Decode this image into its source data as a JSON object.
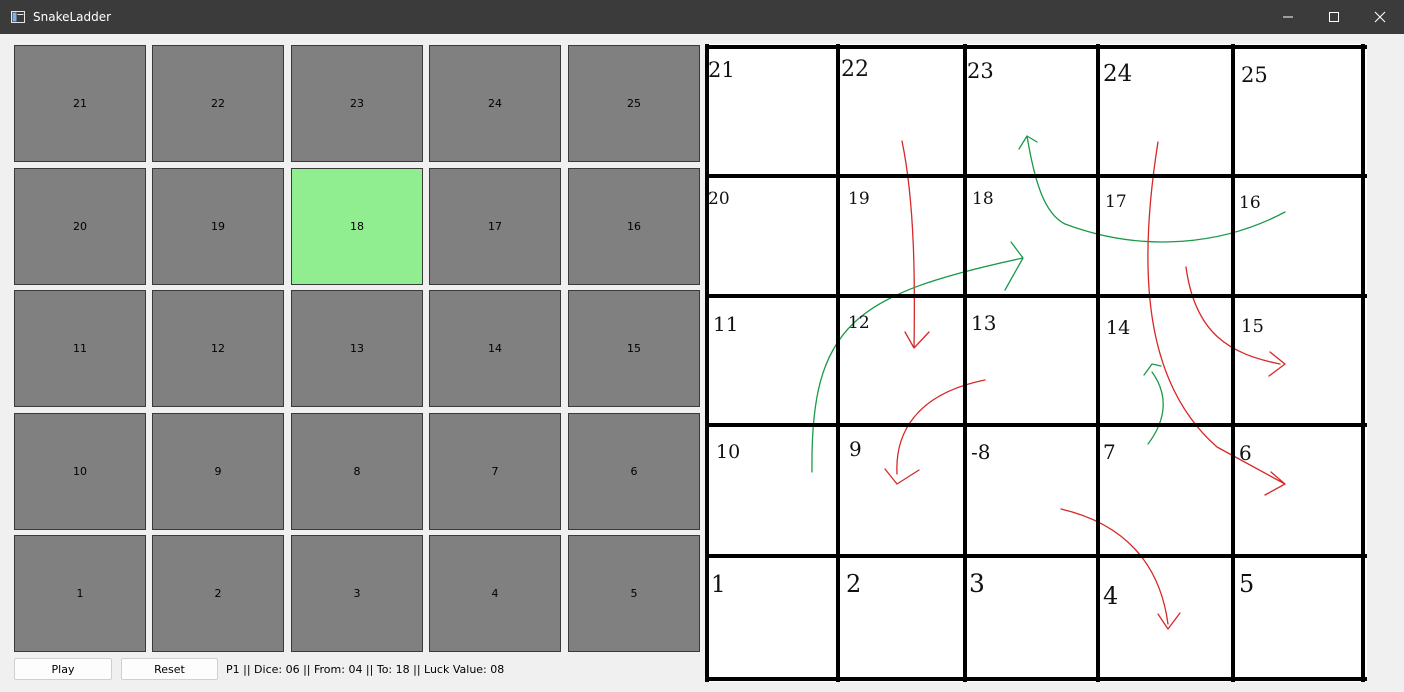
{
  "window": {
    "title": "SnakeLadder",
    "controls": [
      "minimize",
      "maximize",
      "close"
    ]
  },
  "colors": {
    "tile_default": "#808080",
    "tile_active": "#90ee90",
    "snake": "#e02020",
    "ladder": "#1a9a48",
    "grid": "#000000"
  },
  "game_board": {
    "rows": [
      [
        21,
        22,
        23,
        24,
        25
      ],
      [
        20,
        19,
        18,
        17,
        16
      ],
      [
        11,
        12,
        13,
        14,
        15
      ],
      [
        10,
        9,
        8,
        7,
        6
      ],
      [
        1,
        2,
        3,
        4,
        5
      ]
    ],
    "active_tile": 18
  },
  "controls": {
    "play_label": "Play",
    "reset_label": "Reset"
  },
  "status": {
    "text": "P1 || Dice: 06 || From: 04 || To: 18 || Luck Value: 08"
  },
  "drawn_board": {
    "rows": [
      [
        "21",
        "22",
        "23",
        "24",
        "25"
      ],
      [
        "20",
        "19",
        "18",
        "17",
        "16"
      ],
      [
        "11",
        "12",
        "13",
        "14",
        "15"
      ],
      [
        "10",
        "9",
        "-8",
        "7",
        "6"
      ],
      [
        "1",
        "2",
        "3",
        "4",
        "5"
      ]
    ],
    "snakes": [
      {
        "from": 22,
        "to": 12
      },
      {
        "from": 24,
        "to": 6
      },
      {
        "from": 14,
        "to": 15
      },
      {
        "from": 13,
        "to": 9
      },
      {
        "from": 8,
        "to": 4
      }
    ],
    "ladders": [
      {
        "from": 10,
        "to": 18
      },
      {
        "from": 16,
        "to": 23
      },
      {
        "from": 7,
        "to": 14
      }
    ]
  }
}
